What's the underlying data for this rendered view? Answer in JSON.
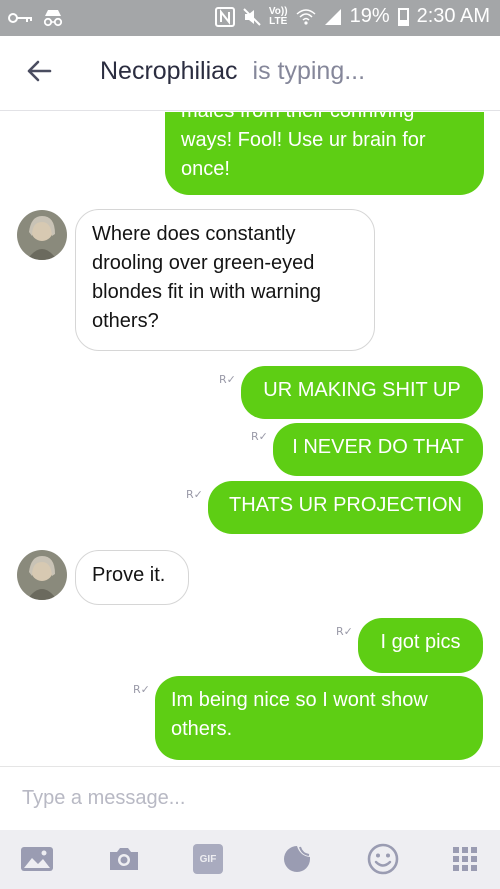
{
  "status_bar": {
    "network": "LTE",
    "volte": "Vo))",
    "battery": "19%",
    "time": "2:30 AM",
    "icons": [
      "key-icon",
      "incognito-icon",
      "nfc-icon",
      "mute-icon",
      "wifi-icon",
      "signal-icon",
      "battery-icon"
    ]
  },
  "header": {
    "contact_name": "Necrophiliac",
    "status": "is typing..."
  },
  "messages": [
    {
      "direction": "out",
      "text": "males from their conniving ways! Fool! Use ur brain for once!"
    },
    {
      "direction": "in",
      "text": "Where does constantly drooling over green-eyed blondes fit in with warning others?"
    },
    {
      "direction": "out",
      "text": "UR MAKING SHIT UP",
      "receipt": "R"
    },
    {
      "direction": "out",
      "text": "I NEVER DO THAT",
      "receipt": "R"
    },
    {
      "direction": "out",
      "text": "THATS UR PROJECTION",
      "receipt": "R"
    },
    {
      "direction": "in",
      "text": "Prove it."
    },
    {
      "direction": "out",
      "text": "I got pics",
      "receipt": "R"
    },
    {
      "direction": "out",
      "text": "Im being nice so I wont show others.",
      "receipt": "R"
    }
  ],
  "input": {
    "placeholder": "Type a message..."
  },
  "toolbar": {
    "gif_label": "GIF",
    "items": [
      "gallery-icon",
      "camera-icon",
      "gif-icon",
      "sticker-icon",
      "emoji-icon",
      "keypad-icon"
    ]
  },
  "colors": {
    "outgoing_bubble": "#5ece14",
    "status_bar": "#a4a6a8",
    "toolbar_bg": "#eeeef2"
  }
}
